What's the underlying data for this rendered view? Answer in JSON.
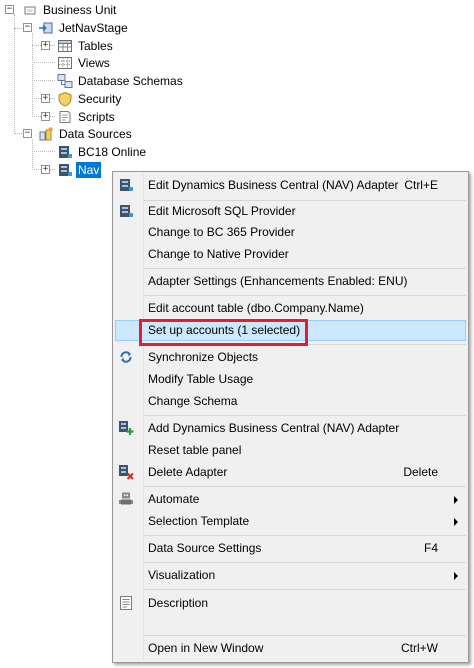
{
  "colors": {
    "selection": "#0078d7",
    "menu_background": "#f0f0f0",
    "menu_highlight": "#cce8ff",
    "callout": "#e0202a"
  },
  "tree": {
    "root": {
      "label": "Business Unit",
      "icon": "business-unit-icon"
    },
    "stage": {
      "label": "JetNavStage",
      "icon": "data-warehouse-icon"
    },
    "children": [
      {
        "label": "Tables",
        "icon": "table-icon"
      },
      {
        "label": "Views",
        "icon": "view-icon"
      },
      {
        "label": "Database Schemas",
        "icon": "database-schema-icon"
      },
      {
        "label": "Security",
        "icon": "security-shield-icon"
      },
      {
        "label": "Scripts",
        "icon": "script-icon"
      }
    ],
    "data_sources": {
      "label": "Data Sources",
      "icon": "data-sources-icon"
    },
    "sources": [
      {
        "label": "BC18 Online",
        "icon": "adapter-icon"
      },
      {
        "label": "Nav",
        "icon": "adapter-icon",
        "selected": true
      }
    ]
  },
  "menu": {
    "items": [
      {
        "label": "Edit Dynamics Business Central (NAV) Adapter",
        "shortcut": "Ctrl+E",
        "icon": "adapter-icon"
      },
      {
        "label": "Edit Microsoft SQL Provider",
        "icon": "adapter-icon"
      },
      {
        "label": "Change to BC 365 Provider"
      },
      {
        "label": "Change to Native Provider"
      },
      {
        "label": "Adapter Settings (Enhancements Enabled: ENU)"
      },
      {
        "label": "Edit account table (dbo.Company.Name)"
      },
      {
        "label": "Set up accounts (1 selected)",
        "highlighted": true
      },
      {
        "label": "Synchronize Objects",
        "icon": "sync-icon"
      },
      {
        "label": "Modify Table Usage"
      },
      {
        "label": "Change Schema"
      },
      {
        "label": "Add Dynamics Business Central (NAV) Adapter",
        "icon": "add-adapter-icon"
      },
      {
        "label": "Reset table panel"
      },
      {
        "label": "Delete Adapter",
        "shortcut": "Delete",
        "icon": "delete-adapter-icon"
      },
      {
        "label": "Automate",
        "icon": "robot-icon",
        "submenu": true
      },
      {
        "label": "Selection Template",
        "submenu": true
      },
      {
        "label": "Data Source Settings",
        "shortcut": "F4"
      },
      {
        "label": "Visualization",
        "submenu": true
      },
      {
        "label": "Description",
        "icon": "description-icon"
      },
      {
        "label": "Open in New Window",
        "shortcut": "Ctrl+W"
      }
    ]
  }
}
